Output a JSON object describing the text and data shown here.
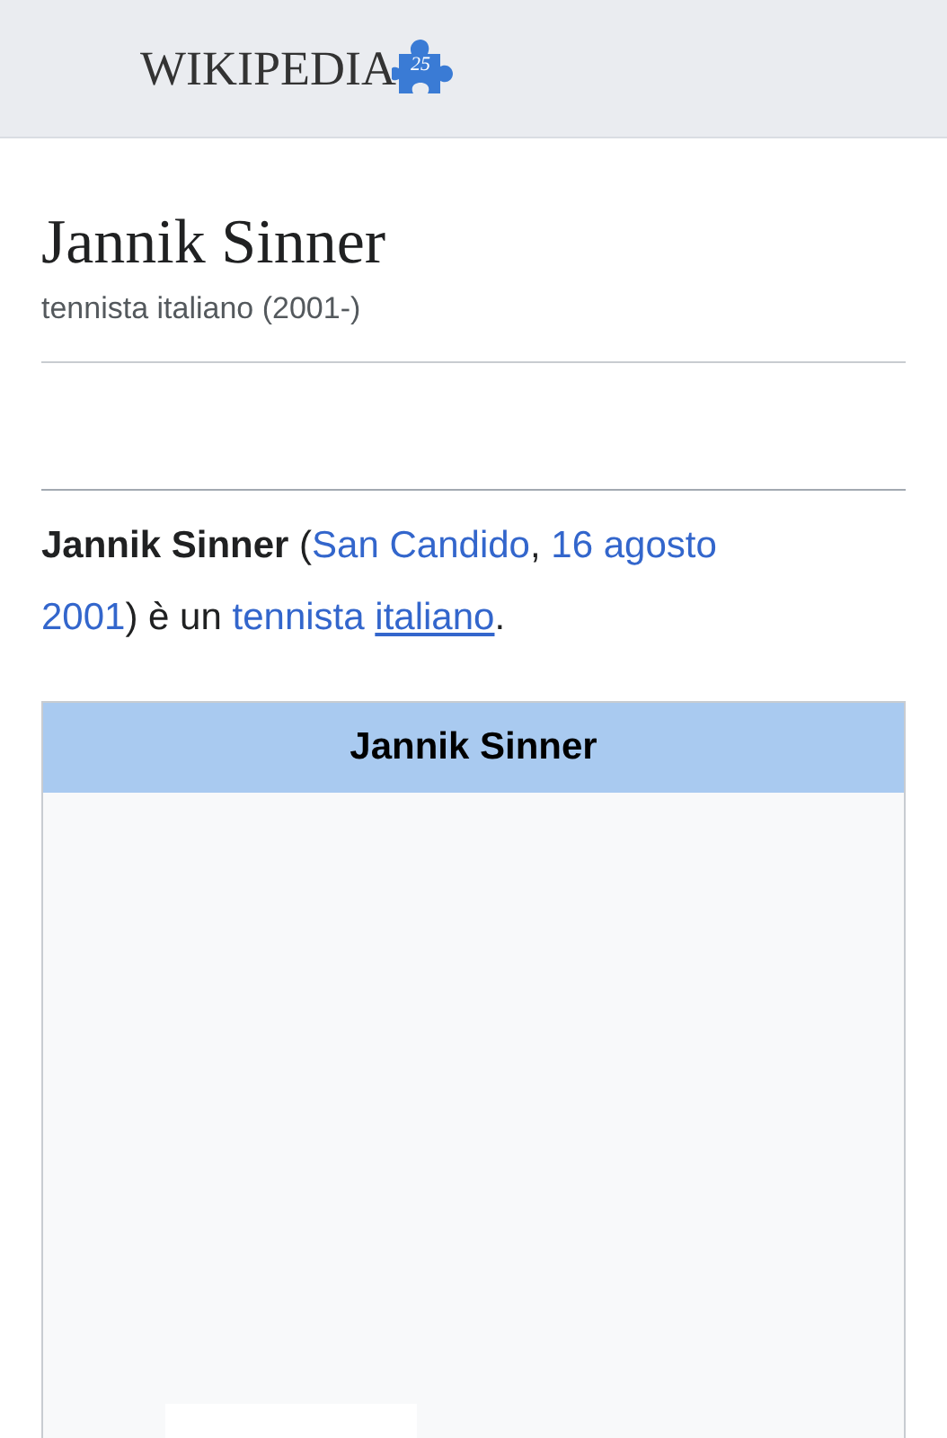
{
  "header": {
    "logo_text": "WIKIPEDIA",
    "logo_badge": "25"
  },
  "page": {
    "title": "Jannik Sinner",
    "subtitle": "tennista italiano (2001-)"
  },
  "intro": [
    {
      "kind": "bold",
      "text": "Jannik Sinner"
    },
    {
      "kind": "text",
      "text": " ("
    },
    {
      "kind": "link",
      "text": "San Candido",
      "underlined": false
    },
    {
      "kind": "text",
      "text": ", "
    },
    {
      "kind": "link",
      "text": "16 agosto",
      "underlined": false
    },
    {
      "kind": "link",
      "text": "2001",
      "underlined": false,
      "space_before": true
    },
    {
      "kind": "text",
      "text": ") è un "
    },
    {
      "kind": "link",
      "text": "tennista",
      "underlined": false
    },
    {
      "kind": "link",
      "text": "italiano",
      "underlined": true,
      "space_before": true
    },
    {
      "kind": "text",
      "text": "."
    }
  ],
  "infobox": {
    "title": "Jannik Sinner"
  }
}
